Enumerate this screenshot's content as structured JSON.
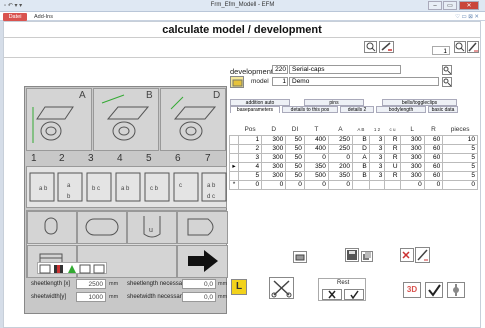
{
  "window": {
    "title": "Frm_Efm_Modell - EFM",
    "qat": "▫ ↶ ▾ ▾",
    "minimize": "–",
    "maximize": "▭",
    "close": "✕"
  },
  "ribbon": {
    "file_tab": "Datei",
    "addins_tab": "Add-Ins",
    "right_icons": "♡ ▭ ⊠ ✕"
  },
  "form": {
    "title": "calculate model / development",
    "top_number": "1"
  },
  "development": {
    "label": "development",
    "number": "220",
    "name": "Serial-caps",
    "model_label": "model",
    "model_number": "1",
    "model_name": "Demo"
  },
  "tabs_top": [
    "addition auto",
    "pins",
    "bells/toggleclips"
  ],
  "tabs_bottom": [
    "baseparameters",
    "details to this pos",
    "details 2",
    "bodylength",
    "basic data"
  ],
  "shape_letters": [
    "A",
    "B",
    "D"
  ],
  "shape_numbers": [
    "1",
    "2",
    "3",
    "4",
    "5",
    "6",
    "7"
  ],
  "grid": {
    "headers": [
      "Pos",
      "D",
      "DI",
      "T",
      "A",
      "A B",
      "1 2",
      "c u",
      "L",
      "R",
      "pieces"
    ],
    "rows": [
      [
        "",
        "1",
        "300",
        "50",
        "400",
        "250",
        "B",
        "3",
        "R",
        "300",
        "60",
        "10"
      ],
      [
        "",
        "2",
        "300",
        "50",
        "400",
        "250",
        "D",
        "3",
        "R",
        "300",
        "60",
        "5"
      ],
      [
        "",
        "3",
        "300",
        "50",
        "0",
        "0",
        "A",
        "3",
        "R",
        "300",
        "60",
        "5"
      ],
      [
        "▸",
        "4",
        "300",
        "50",
        "350",
        "200",
        "B",
        "3",
        "U",
        "300",
        "60",
        "5"
      ],
      [
        "",
        "5",
        "300",
        "50",
        "500",
        "350",
        "B",
        "3",
        "R",
        "300",
        "60",
        "5"
      ],
      [
        "*",
        "0",
        "0",
        "0",
        "0",
        "0",
        "",
        "",
        "",
        "0",
        "0",
        "0"
      ]
    ]
  },
  "sheet": {
    "length_label": "sheetlength [x]",
    "length_value": "2500",
    "length_unit": "mm",
    "width_label": "sheetwidth[y]",
    "width_value": "1000",
    "width_unit": "mm",
    "length_nec_label": "sheetlength necessary",
    "length_nec_value": "0,0",
    "length_nec_unit": "mm",
    "width_nec_label": "sheetwidth necessary",
    "width_nec_value": "0,0",
    "width_nec_unit": "mm"
  },
  "buttons": {
    "rest": "Rest",
    "threeD": "3D",
    "L": "L"
  },
  "colors": {
    "accent_red": "#d9534f",
    "yellow": "#f2d21b",
    "arrow": "#111111"
  }
}
